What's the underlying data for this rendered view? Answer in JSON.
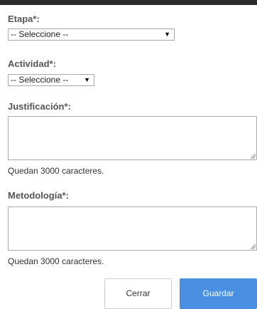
{
  "form": {
    "etapa": {
      "label": "Etapa*:",
      "value": "-- Seleccione --"
    },
    "actividad": {
      "label": "Actividad*:",
      "value": "-- Seleccione --"
    },
    "justificacion": {
      "label": "Justificación*:",
      "value": "",
      "counter": "Quedan 3000 caracteres."
    },
    "metodologia": {
      "label": "Metodología*:",
      "value": "",
      "counter": "Quedan 3000 caracteres."
    }
  },
  "buttons": {
    "cerrar": "Cerrar",
    "guardar": "Guardar"
  },
  "icons": {
    "dropdown_caret": "caret-down-icon",
    "resize_grip": "resize-grip-icon"
  },
  "colors": {
    "primary_button": "#4a90e2",
    "label_text": "#555555"
  }
}
